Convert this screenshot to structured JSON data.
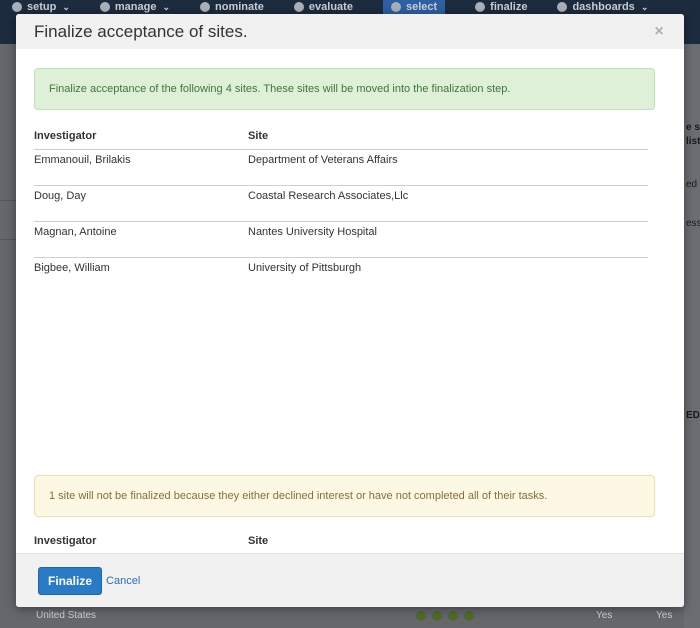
{
  "background": {
    "nav": [
      {
        "label": "setup",
        "icon": "gear-icon",
        "caret": true
      },
      {
        "label": "manage",
        "icon": "user-icon",
        "caret": true
      },
      {
        "label": "nominate",
        "icon": "thumbs-up-icon",
        "caret": false
      },
      {
        "label": "evaluate",
        "icon": "search-icon",
        "caret": false
      },
      {
        "label": "select",
        "icon": "list-icon",
        "caret": false,
        "active": true
      },
      {
        "label": "finalize",
        "icon": "check-circle-icon",
        "caret": false
      },
      {
        "label": "dashboards",
        "icon": "pie-chart-icon",
        "caret": true
      }
    ],
    "right_fragments": [
      "e sit",
      "list",
      "ed (",
      "ess",
      "ED"
    ],
    "bottom_row_text": "United States",
    "bottom_row_yes": [
      "Yes",
      "Yes"
    ]
  },
  "modal": {
    "title": "Finalize acceptance of sites.",
    "close_label": "×",
    "success_message": "Finalize acceptance of the following 4 sites. These sites will be moved into the finalization step.",
    "table": {
      "headers": [
        "Investigator",
        "Site"
      ],
      "rows": [
        {
          "investigator": "Emmanouil, Brilakis",
          "site": "Department of Veterans Affairs"
        },
        {
          "investigator": "Doug, Day",
          "site": "Coastal Research Associates,Llc"
        },
        {
          "investigator": "Magnan, Antoine",
          "site": "Nantes University Hospital"
        },
        {
          "investigator": "Bigbee, William",
          "site": "University of Pittsburgh"
        }
      ]
    },
    "warning_message": "1 site will not be finalized because they either declined interest or have not completed all of their tasks.",
    "table2": {
      "headers": [
        "Investigator",
        "Site"
      ]
    },
    "footer": {
      "finalize_label": "Finalize",
      "cancel_label": "Cancel"
    }
  }
}
